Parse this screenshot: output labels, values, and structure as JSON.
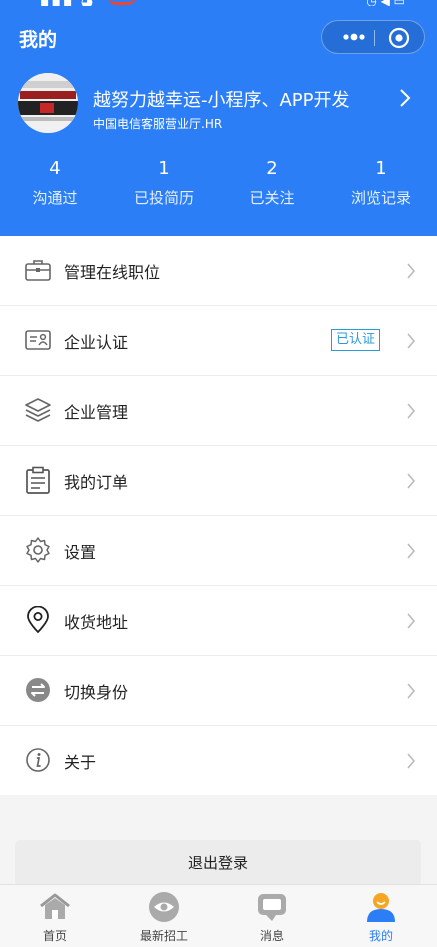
{
  "header": {
    "title": "我的",
    "profile": {
      "name": "越努力越幸运-小程序、APP开发",
      "subtitle": "中国电信客服营业厅.HR"
    },
    "stats": [
      {
        "value": "4",
        "label": "沟通过"
      },
      {
        "value": "1",
        "label": "已投简历"
      },
      {
        "value": "2",
        "label": "已关注"
      },
      {
        "value": "1",
        "label": "浏览记录"
      }
    ]
  },
  "menu": {
    "items": [
      {
        "label": "管理在线职位",
        "icon": "briefcase-icon"
      },
      {
        "label": "企业认证",
        "icon": "id-card-icon",
        "badge": "已认证"
      },
      {
        "label": "企业管理",
        "icon": "layers-icon"
      },
      {
        "label": "我的订单",
        "icon": "clipboard-icon"
      },
      {
        "label": "设置",
        "icon": "gear-icon"
      },
      {
        "label": "收货地址",
        "icon": "location-pin-icon"
      },
      {
        "label": "切换身份",
        "icon": "switch-icon"
      },
      {
        "label": "关于",
        "icon": "info-icon"
      }
    ]
  },
  "logout_label": "退出登录",
  "tabbar": {
    "items": [
      {
        "label": "首页",
        "icon": "home-icon"
      },
      {
        "label": "最新招工",
        "icon": "eye-icon"
      },
      {
        "label": "消息",
        "icon": "message-icon"
      },
      {
        "label": "我的",
        "icon": "user-icon",
        "active": true
      }
    ]
  },
  "colors": {
    "primary": "#2b7ef5",
    "badge": "#2b9bd8",
    "background": "#f4f4f4"
  }
}
